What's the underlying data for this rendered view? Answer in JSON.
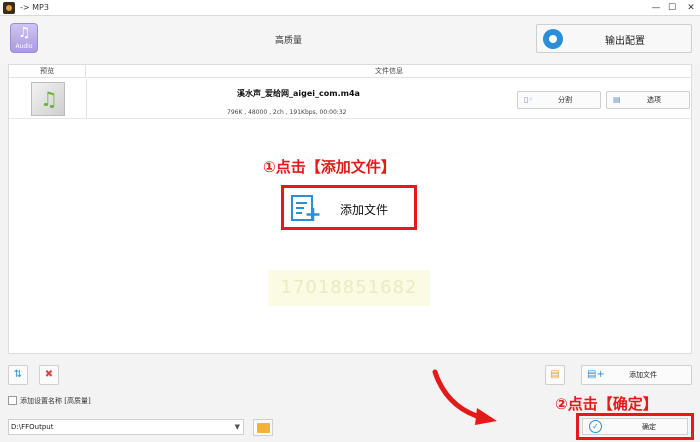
{
  "window": {
    "title": "-> MP3",
    "min_label": "—",
    "max_label": "☐",
    "close_label": "✕"
  },
  "header": {
    "audio_icon_label": "Audio",
    "quality_label": "高质量",
    "output_config_label": "输出配置"
  },
  "file_list": {
    "columns": {
      "preview": "预览",
      "file_info": "文件信息"
    },
    "rows": [
      {
        "file_name": "溪水声_爱给网_aigei_com.m4a",
        "meta": "796K , 48000 , 2ch , 191Kbps, 00:00:32",
        "split_label": "分割",
        "options_label": "选项"
      }
    ]
  },
  "annotations": {
    "step1": "①点击【添加文件】",
    "step2": "②点击【确定】"
  },
  "add_file_big_label": "添加文件",
  "watermark_text": "17018851682",
  "bottom": {
    "add_file_label": "添加文件",
    "checkbox_label": "添加设置名称 [高质量]",
    "output_path": "D:\\FFOutput",
    "ok_label": "确定"
  },
  "colors": {
    "accent": "#2a8fd8",
    "annotation": "#e41a1a",
    "folder": "#f0b43a"
  }
}
